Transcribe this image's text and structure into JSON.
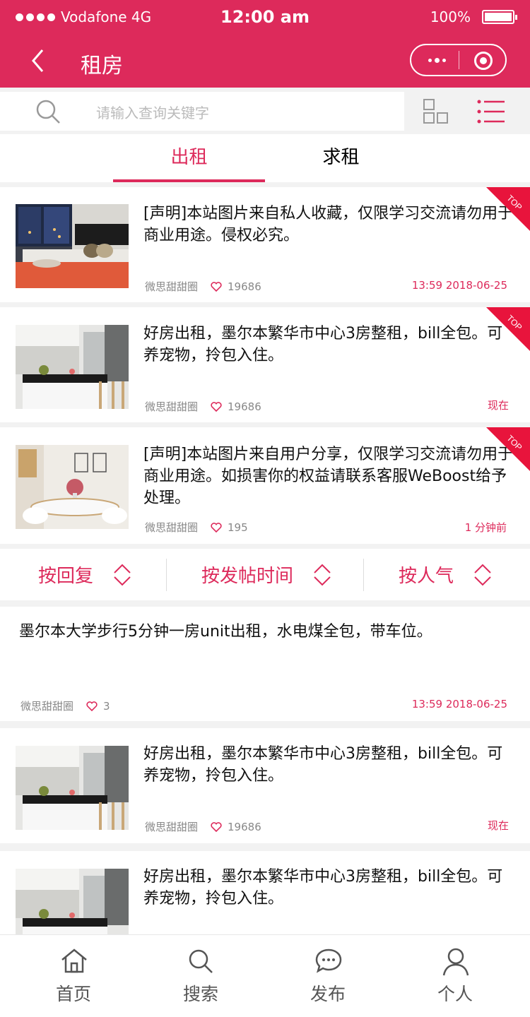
{
  "status_bar": {
    "carrier": "Vodafone 4G",
    "time": "12:00 am",
    "battery": "100%"
  },
  "nav": {
    "title": "租房"
  },
  "search": {
    "placeholder": "请输入查询关键字"
  },
  "tabs": [
    {
      "label": "出租",
      "active": true
    },
    {
      "label": "求租",
      "active": false
    }
  ],
  "top_badge": "TOP",
  "sort_options": [
    {
      "label": "按回复"
    },
    {
      "label": "按发帖时间"
    },
    {
      "label": "按人气"
    }
  ],
  "posts": [
    {
      "title": "[声明]本站图片来自私人收藏，仅限学习交流请勿用于商业用途。侵权必究。",
      "author": "微思甜甜圈",
      "likes": "19686",
      "time": "13:59 2018-06-25",
      "top": true,
      "image": "bedroom"
    },
    {
      "title": "好房出租，墨尔本繁华市中心3房整租，bill全包。可养宠物，拎包入住。",
      "author": "微思甜甜圈",
      "likes": "19686",
      "time": "现在",
      "top": true,
      "image": "kitchen"
    },
    {
      "title": "[声明]本站图片来自用户分享，仅限学习交流请勿用于商业用途。如损害你的权益请联系客服WeBoost给予处理。",
      "author": "微思甜甜圈",
      "likes": "195",
      "time": "1 分钟前",
      "top": true,
      "image": "dining"
    },
    {
      "title": "墨尔本大学步行5分钟一房unit出租，水电煤全包，带车位。",
      "author": "微思甜甜圈",
      "likes": "3",
      "time": "13:59 2018-06-25",
      "top": false,
      "image": "none"
    },
    {
      "title": "好房出租，墨尔本繁华市中心3房整租，bill全包。可养宠物，拎包入住。",
      "author": "微思甜甜圈",
      "likes": "19686",
      "time": "现在",
      "top": false,
      "image": "kitchen"
    },
    {
      "title": "好房出租，墨尔本繁华市中心3房整租，bill全包。可养宠物，拎包入住。",
      "author": "",
      "likes": "",
      "time": "",
      "top": false,
      "image": "kitchen"
    }
  ],
  "tabbar": [
    {
      "label": "首页",
      "icon": "home-icon"
    },
    {
      "label": "搜索",
      "icon": "search-icon"
    },
    {
      "label": "发布",
      "icon": "chat-icon"
    },
    {
      "label": "个人",
      "icon": "user-icon"
    }
  ],
  "colors": {
    "accent": "#dd2a5b",
    "badge": "#e8143c"
  }
}
